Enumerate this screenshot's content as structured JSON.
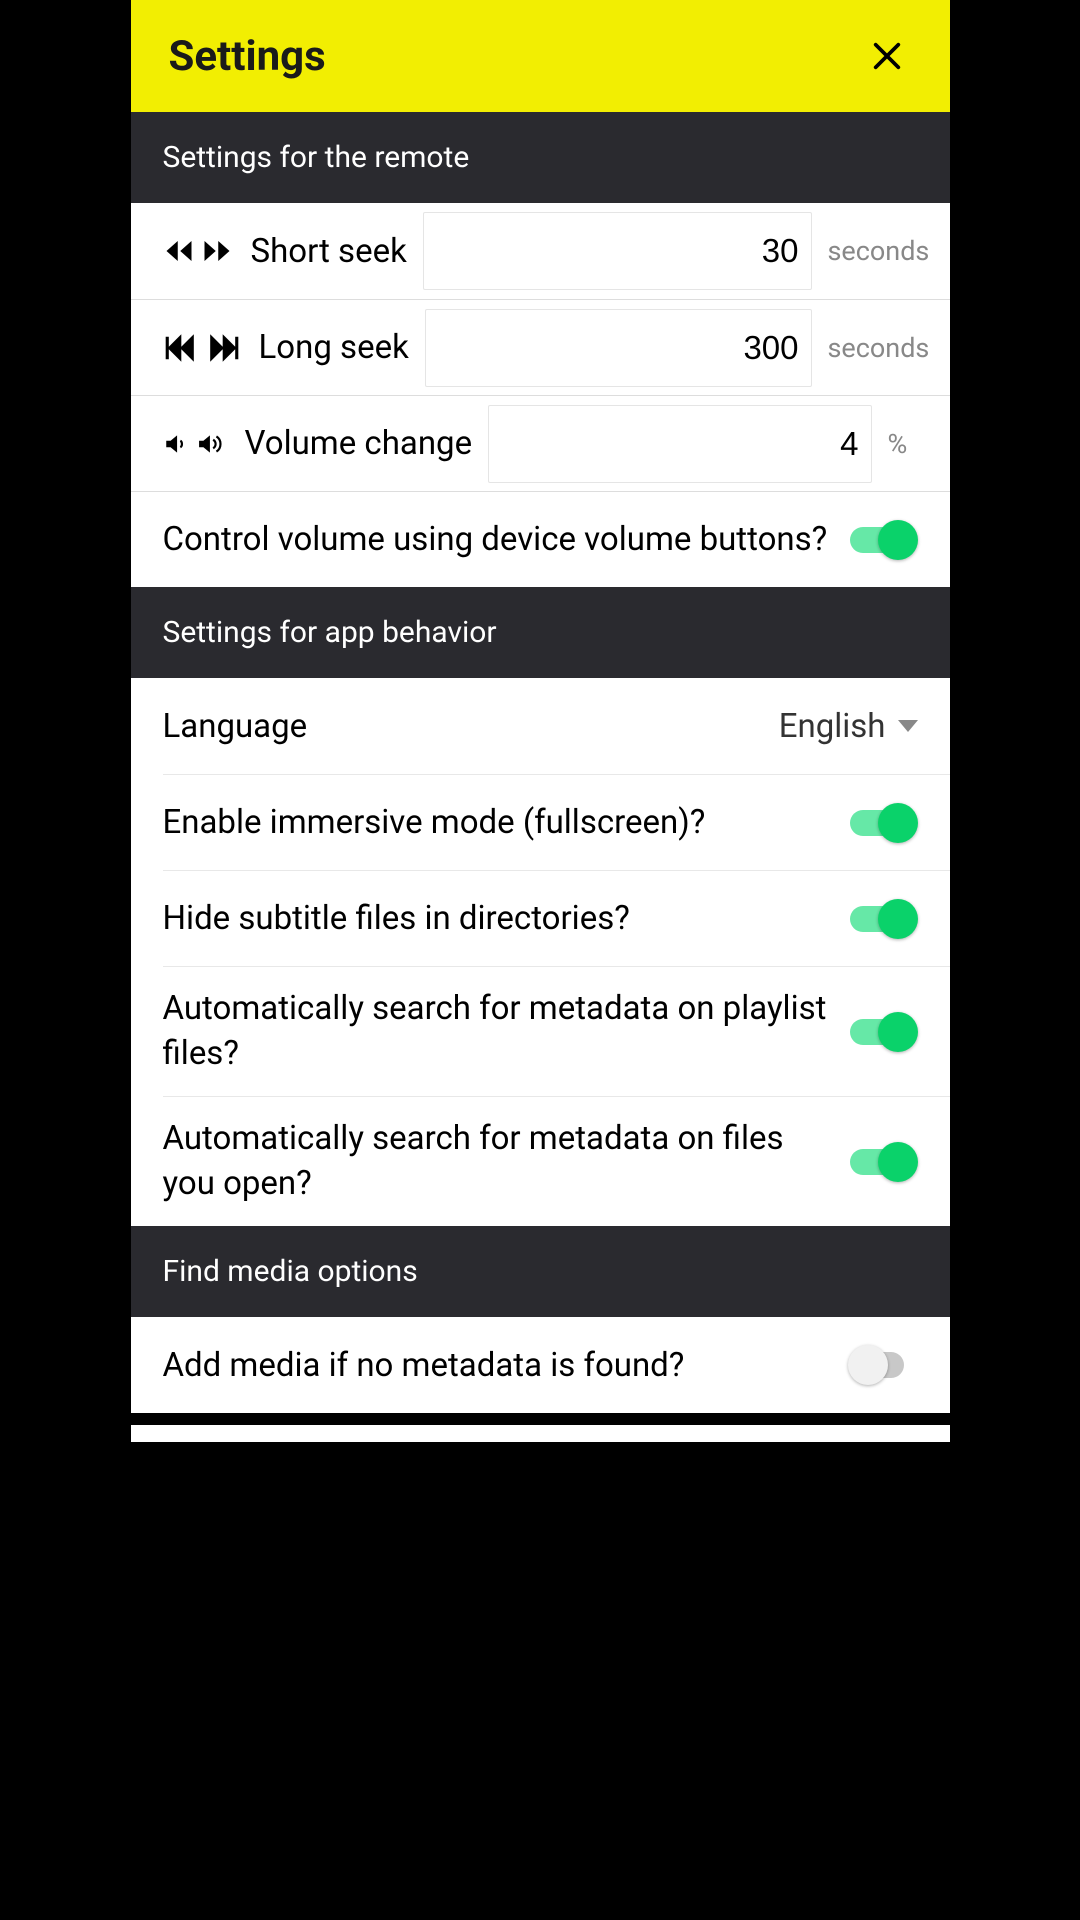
{
  "header": {
    "title": "Settings"
  },
  "sections": {
    "remote": {
      "title": "Settings for the remote",
      "short_seek_label": "Short seek",
      "short_seek_value": "30",
      "long_seek_label": "Long seek",
      "long_seek_value": "300",
      "seconds_unit": "seconds",
      "volume_change_label": "Volume change",
      "volume_change_value": "4",
      "percent_unit": "%",
      "device_volume_label": "Control volume using device volume buttons?"
    },
    "behavior": {
      "title": "Settings for app behavior",
      "language_label": "Language",
      "language_value": "English",
      "immersive_label": "Enable immersive mode (fullscreen)?",
      "hide_subs_label": "Hide subtitle files in directories?",
      "auto_meta_playlist_label": "Automatically search for metadata on playlist files?",
      "auto_meta_open_label": "Automatically search for metadata on files you open?"
    },
    "findmedia": {
      "title": "Find media options",
      "add_if_none_label": "Add media if no metadata is found?"
    }
  }
}
